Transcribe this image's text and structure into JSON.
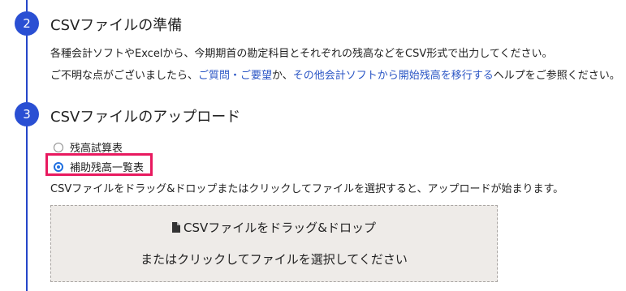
{
  "steps": [
    {
      "number": "2",
      "title": "CSVファイルの準備",
      "description": "各種会計ソフトやExcelから、今期期首の勘定科目とそれぞれの残高などをCSV形式で出力してください。",
      "help": {
        "prefix": "ご不明な点がございましたら、",
        "link1": "ご質問・ご要望",
        "middle": "か、",
        "link2": "その他会計ソフトから開始残高を移行する",
        "suffix": "ヘルプをご参照ください。"
      }
    },
    {
      "number": "3",
      "title": "CSVファイルのアップロード",
      "radio_options": [
        {
          "label": "残高試算表",
          "checked": false
        },
        {
          "label": "補助残高一覧表",
          "checked": true
        }
      ],
      "instruction": "CSVファイルをドラッグ&ドロップまたはクリックしてファイルを選択すると、アップロードが始まります。",
      "dropzone": {
        "icon": "file-icon",
        "line1": "CSVファイルをドラッグ&ドロップ",
        "line2": "またはクリックしてファイルを選択してください"
      }
    }
  ],
  "colors": {
    "accent": "#2a4fd3",
    "link": "#2b56c5",
    "highlight": "#e8195f",
    "dropzone_bg": "#eeebe8"
  }
}
